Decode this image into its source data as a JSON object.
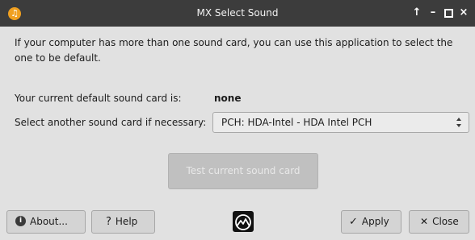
{
  "window": {
    "title": "MX Select Sound",
    "controls": {
      "keep_above": "↑",
      "minimize": "–",
      "close": "×"
    }
  },
  "intro_text": "If your computer has more than one sound card, you can use this application to select the one to be default.",
  "current": {
    "label": "Your current default sound card is:",
    "value": "none"
  },
  "select": {
    "label": "Select another sound card if necessary:",
    "value": "PCH: HDA-Intel - HDA Intel PCH"
  },
  "test_button": {
    "label": "Test current sound card",
    "enabled": false
  },
  "buttons": {
    "about": "About...",
    "help": "Help",
    "apply": "Apply",
    "close": "Close"
  },
  "icons": {
    "app": "music-note-icon",
    "about": "info-icon",
    "help": "question-icon",
    "apply": "check-icon",
    "close": "x-icon",
    "logo": "mx-logo-icon"
  },
  "colors": {
    "titlebar": "#3c3c3c",
    "window_bg": "#e1e1e1",
    "app_icon": "#f0a020",
    "disabled_button": "#c0c0c0"
  }
}
